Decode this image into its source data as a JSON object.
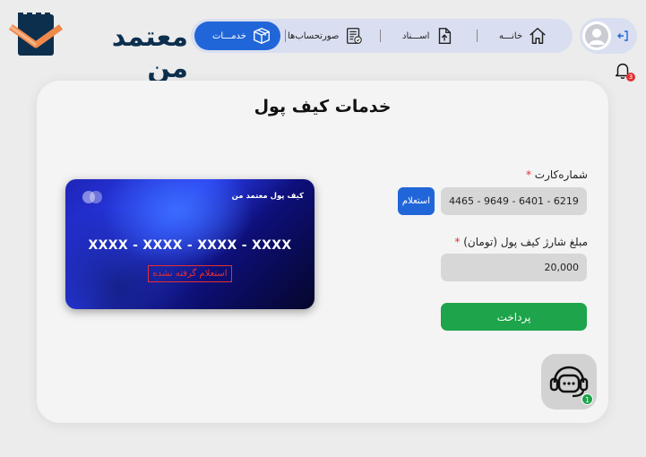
{
  "brand": {
    "name": "معتمد من",
    "accent": "#2166d8",
    "dark": "#0d2f4e",
    "orange": "#f08a4b"
  },
  "nav": {
    "items": [
      {
        "label": "خانـــه",
        "icon": "home-icon",
        "active": false
      },
      {
        "label": "اســـناد",
        "icon": "document-upload-icon",
        "active": false
      },
      {
        "label": "صورتحساب‌ها",
        "icon": "invoice-icon",
        "active": false
      },
      {
        "label": "خدمـــات",
        "icon": "box-icon",
        "active": true
      }
    ]
  },
  "notifications": {
    "count": "3"
  },
  "page": {
    "title": "خدمات کیف پول"
  },
  "form": {
    "card_number_label": "شماره‌کارت",
    "card_number_value": "4465 - 9649 - 6401 - 6219",
    "inquiry_label": "استعلام",
    "amount_label": "مبلغ شارژ کیف پول (تومان)",
    "amount_value": "20,000",
    "required_mark": "*",
    "pay_label": "پرداخت"
  },
  "wallet_card": {
    "title": "کیف پول معتمد من",
    "number": "XXXX - XXXX - XXXX - XXXX",
    "status": "استعلام گرفته نشده"
  },
  "support": {
    "badge": "1",
    "icon": "support-agent-icon"
  },
  "colors": {
    "pay": "#1ea44a",
    "error": "#e03030",
    "panel": "#f4f4f4"
  }
}
